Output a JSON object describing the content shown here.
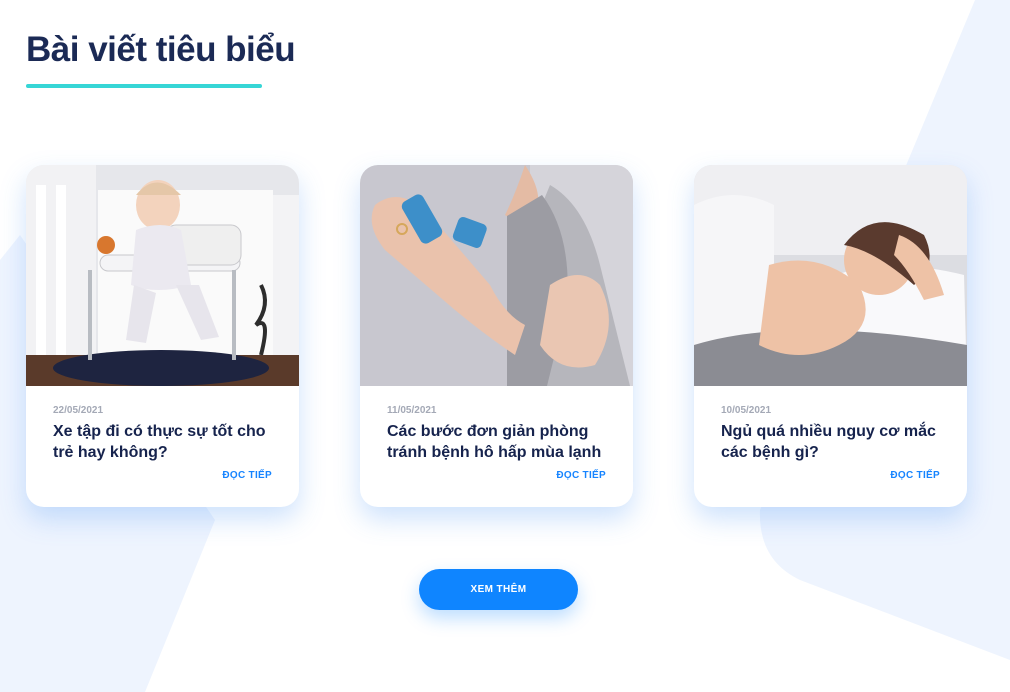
{
  "section": {
    "title": "Bài viết tiêu biểu"
  },
  "articles": [
    {
      "date": "22/05/2021",
      "title": "Xe tập đi có thực sự tốt cho trẻ hay không?",
      "read_more": "ĐỌC TIẾP",
      "image": "baby-in-walker-photo"
    },
    {
      "date": "11/05/2021",
      "title": "Các bước đơn giản phòng tránh bệnh hô hấp mùa lạnh",
      "read_more": "ĐỌC TIẾP",
      "image": "woman-using-inhaler-photo"
    },
    {
      "date": "10/05/2021",
      "title": "Ngủ quá nhiều nguy cơ mắc các bệnh gì?",
      "read_more": "ĐỌC TIẾP",
      "image": "woman-sleeping-photo"
    }
  ],
  "more_button": {
    "label": "XEM THÊM"
  },
  "colors": {
    "heading": "#1b2a55",
    "underline": "#36d6d6",
    "accent": "#0f85ff",
    "date": "#a4a9b6",
    "background_shape": "#eef5ff"
  }
}
